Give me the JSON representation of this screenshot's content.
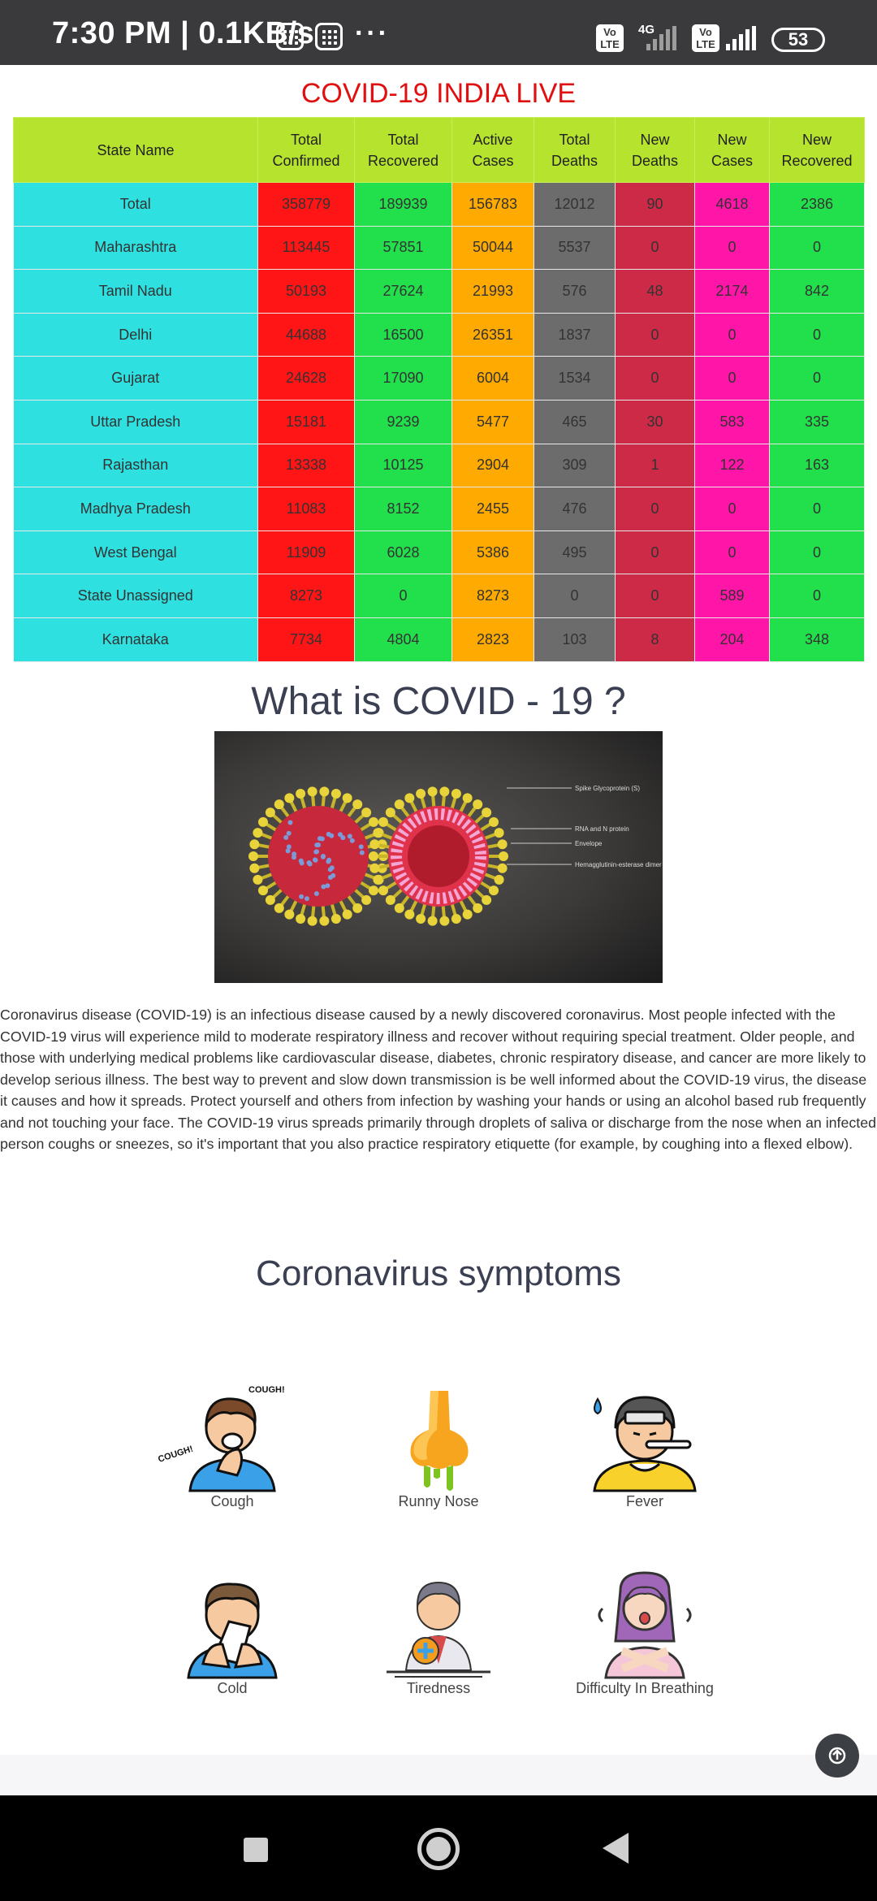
{
  "status_bar": {
    "time": "7:30 PM | 0.1KB/s",
    "more": "···",
    "volte": "Vo LTE",
    "network": "4G",
    "battery": "53"
  },
  "page": {
    "title": "COVID-19 INDIA LIVE",
    "what_heading": "What is COVID - 19 ?",
    "description": "Coronavirus disease (COVID-19) is an infectious disease caused by a newly discovered coronavirus. Most people infected with the COVID-19 virus will experience mild to moderate respiratory illness and recover without requiring special treatment. Older people, and those with underlying medical problems like cardiovascular disease, diabetes, chronic respiratory disease, and cancer are more likely to develop serious illness. The best way to prevent and slow down transmission is be well informed about the COVID-19 virus, the disease it causes and how it spreads. Protect yourself and others from infection by washing your hands or using an alcohol based rub frequently and not touching your face. The COVID-19 virus spreads primarily through droplets of saliva or discharge from the nose when an infected person coughs or sneezes, so it's important that you also practice respiratory etiquette (for example, by coughing into a flexed elbow).",
    "symptoms_heading": "Coronavirus symptoms"
  },
  "virus_image": {
    "labels": [
      "Spike Glycoprotein (S)",
      "RNA and N protein",
      "Envelope",
      "Hemagglutinin-esterase dimer (HE)"
    ]
  },
  "table": {
    "headers": [
      [
        "State Name"
      ],
      [
        "Total",
        "Confirmed"
      ],
      [
        "Total",
        "Recovered"
      ],
      [
        "Active",
        "Cases"
      ],
      [
        "Total",
        "Deaths"
      ],
      [
        "New",
        "Deaths"
      ],
      [
        "New",
        "Cases"
      ],
      [
        "New",
        "Recovered"
      ]
    ],
    "rows": [
      [
        "Total",
        "358779",
        "189939",
        "156783",
        "12012",
        "90",
        "4618",
        "2386"
      ],
      [
        "Maharashtra",
        "113445",
        "57851",
        "50044",
        "5537",
        "0",
        "0",
        "0"
      ],
      [
        "Tamil Nadu",
        "50193",
        "27624",
        "21993",
        "576",
        "48",
        "2174",
        "842"
      ],
      [
        "Delhi",
        "44688",
        "16500",
        "26351",
        "1837",
        "0",
        "0",
        "0"
      ],
      [
        "Gujarat",
        "24628",
        "17090",
        "6004",
        "1534",
        "0",
        "0",
        "0"
      ],
      [
        "Uttar Pradesh",
        "15181",
        "9239",
        "5477",
        "465",
        "30",
        "583",
        "335"
      ],
      [
        "Rajasthan",
        "13338",
        "10125",
        "2904",
        "309",
        "1",
        "122",
        "163"
      ],
      [
        "Madhya Pradesh",
        "11083",
        "8152",
        "2455",
        "476",
        "0",
        "0",
        "0"
      ],
      [
        "West Bengal",
        "11909",
        "6028",
        "5386",
        "495",
        "0",
        "0",
        "0"
      ],
      [
        "State Unassigned",
        "8273",
        "0",
        "8273",
        "0",
        "0",
        "589",
        "0"
      ],
      [
        "Karnataka",
        "7734",
        "4804",
        "2823",
        "103",
        "8",
        "204",
        "348"
      ]
    ]
  },
  "symptoms": [
    {
      "label": "Cough",
      "icon": "cough-icon"
    },
    {
      "label": "Runny Nose",
      "icon": "runny-nose-icon"
    },
    {
      "label": "Fever",
      "icon": "fever-icon"
    },
    {
      "label": "Cold",
      "icon": "cold-icon"
    },
    {
      "label": "Tiredness",
      "icon": "tiredness-icon"
    },
    {
      "label": "Difficulty In Breathing",
      "icon": "breathing-icon"
    }
  ],
  "cough_bubbles": [
    "COUGH!",
    "COUGH!"
  ]
}
